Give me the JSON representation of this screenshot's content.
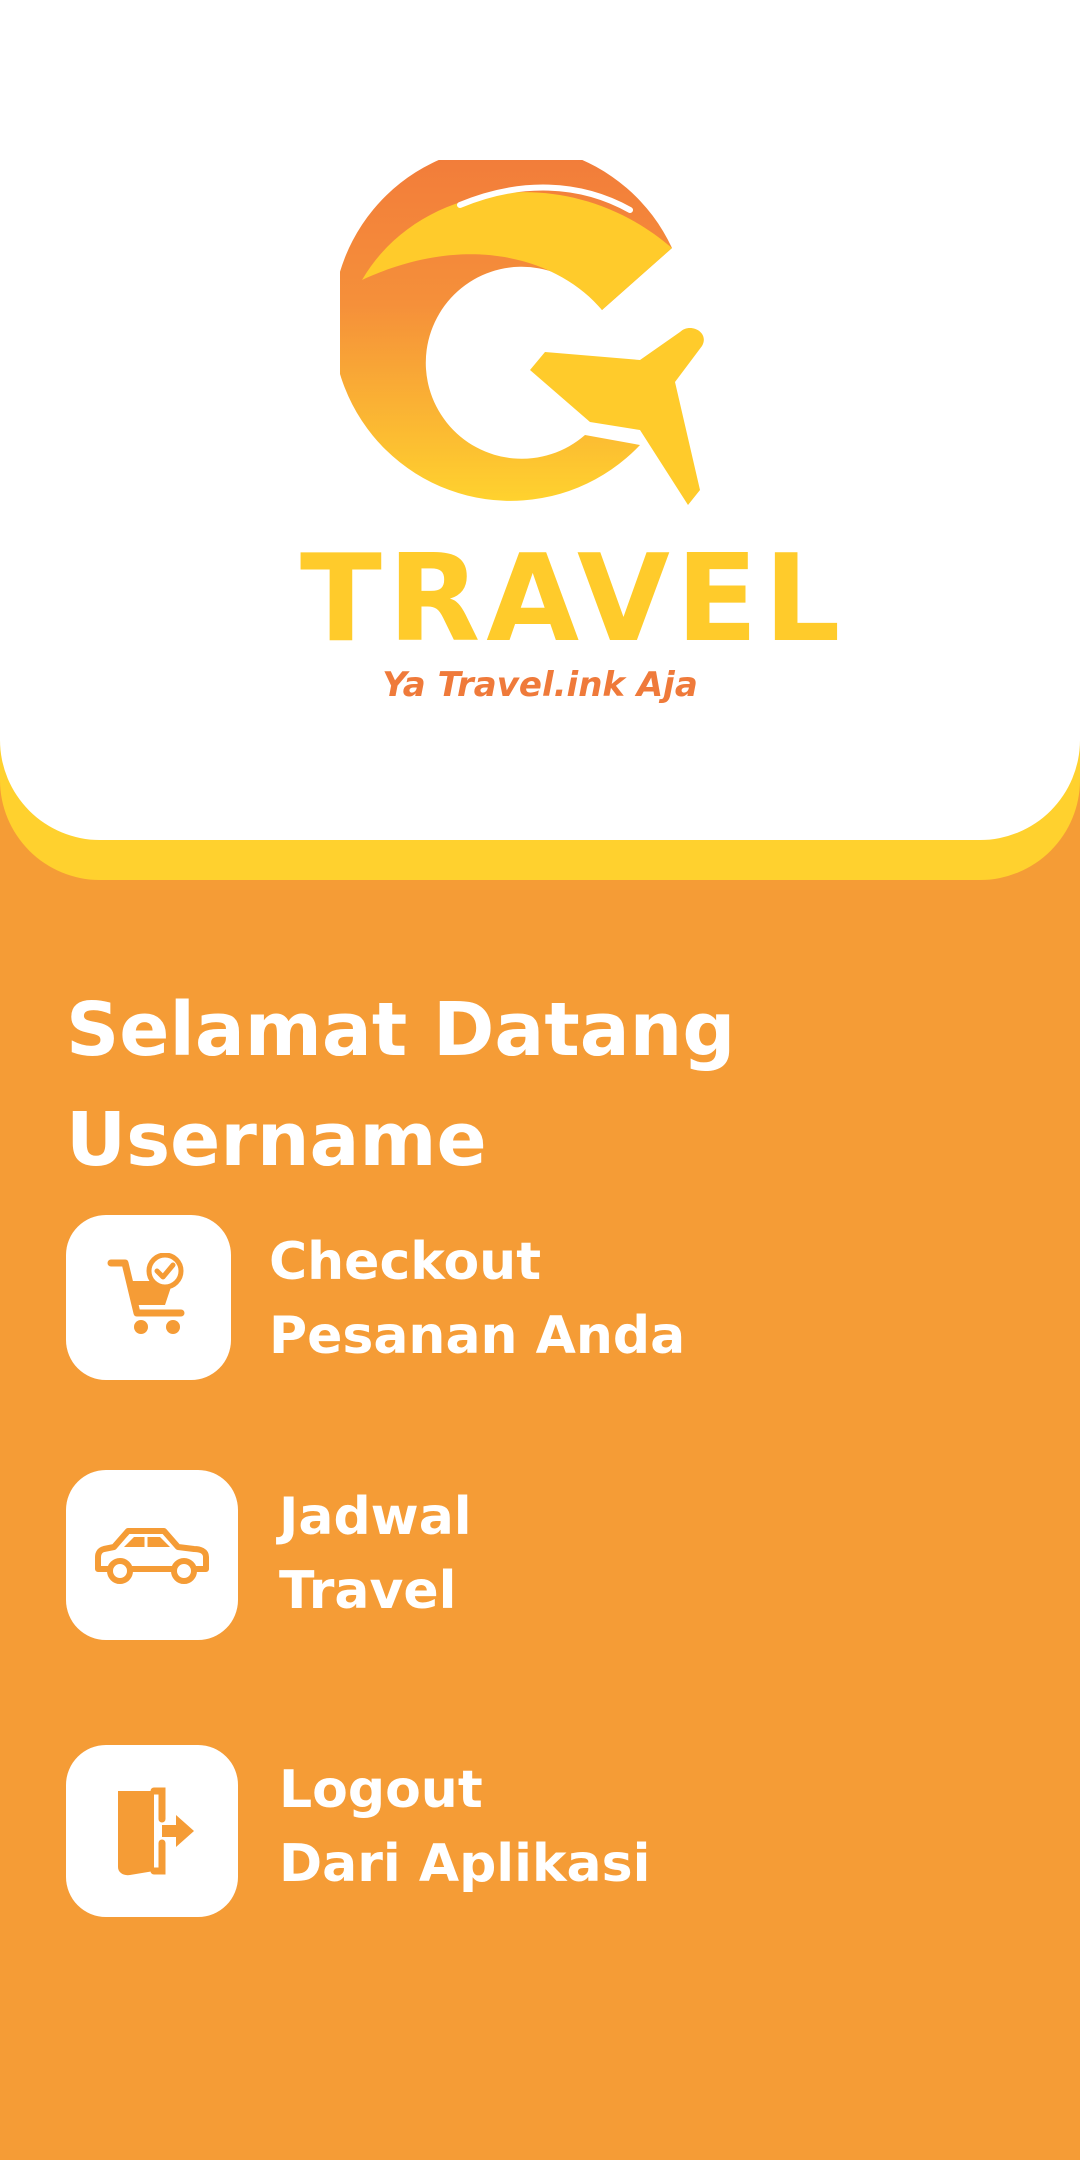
{
  "header": {
    "logo": {
      "wordmark": "TRAVEL",
      "tagline": "Ya Travel.ink Aja"
    }
  },
  "welcome": {
    "line1": "Selamat Datang",
    "line2": "Username"
  },
  "menu": [
    {
      "icon": "cart-check-icon",
      "line1": "Checkout",
      "line2": "Pesanan Anda"
    },
    {
      "icon": "car-icon",
      "line1": "Jadwal",
      "line2": "Travel"
    },
    {
      "icon": "logout-door-icon",
      "line1": "Logout",
      "line2": "Dari Aplikasi"
    }
  ],
  "colors": {
    "background": "#F59C36",
    "header_band": "#FFD12E",
    "header_card": "#FFFFFF",
    "logo_yellow": "#FFCB2B",
    "logo_orange": "#EF7A3A",
    "icon_color": "#F59C36",
    "text": "#FFFFFF"
  }
}
